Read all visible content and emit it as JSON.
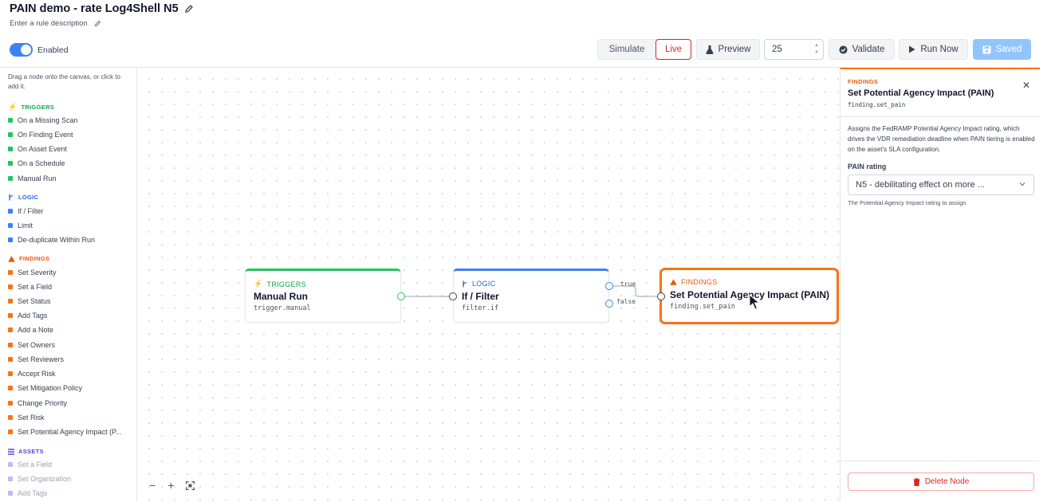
{
  "header": {
    "title": "PAIN demo - rate Log4Shell N5",
    "description_placeholder": "Enter a rule description",
    "enabled_label": "Enabled",
    "enabled": true
  },
  "toolbar": {
    "simulate_label": "Simulate",
    "live_label": "Live",
    "mode": "Live",
    "preview_label": "Preview",
    "preview_count": "25",
    "validate_label": "Validate",
    "run_now_label": "Run Now",
    "saved_label": "Saved"
  },
  "palette": {
    "hint": "Drag a node onto the canvas, or click to add it.",
    "groups": [
      {
        "title": "TRIGGERS",
        "color": "#22c55e",
        "items": [
          "On a Missing Scan",
          "On Finding Event",
          "On Asset Event",
          "On a Schedule",
          "Manual Run"
        ]
      },
      {
        "title": "LOGIC",
        "color": "#3b82f6",
        "items": [
          "If / Filter",
          "Limit",
          "De-duplicate Within Run"
        ]
      },
      {
        "title": "FINDINGS",
        "color": "#f97316",
        "items": [
          "Set Severity",
          "Set a Field",
          "Set Status",
          "Add Tags",
          "Add a Note",
          "Set Owners",
          "Set Reviewers",
          "Accept Risk",
          "Set Mitigation Policy",
          "Change Priority",
          "Set Risk",
          "Set Potential Agency Impact (P..."
        ]
      },
      {
        "title": "ASSETS",
        "color": "#6366f1",
        "items": [
          "Set a Field",
          "Set Organization",
          "Add Tags"
        ]
      }
    ]
  },
  "canvas": {
    "nodes": [
      {
        "category": "TRIGGERS",
        "title": "Manual Run",
        "code": "trigger.manual",
        "color": "#22c55e"
      },
      {
        "category": "LOGIC",
        "title": "If / Filter",
        "code": "filter.if",
        "color": "#3b82f6"
      },
      {
        "category": "FINDINGS",
        "title": "Set Potential Agency Impact (PAIN)",
        "code": "finding.set_pain",
        "color": "#f97316"
      }
    ],
    "ports": {
      "true_label": "true",
      "false_label": "false"
    },
    "zoom_out": "−",
    "zoom_in": "+"
  },
  "inspector": {
    "category": "FINDINGS",
    "title": "Set Potential Agency Impact (PAIN)",
    "code": "finding.set_pain",
    "description": "Assigns the FedRAMP Potential Agency Impact rating, which drives the VDR remediation deadline when PAIN tiering is enabled on the asset's SLA configuration.",
    "field_label": "PAIN rating",
    "field_value": "N5 - debilitating effect on more ...",
    "field_help": "The Potential Agency Impact rating to assign.",
    "delete_label": "Delete Node"
  }
}
